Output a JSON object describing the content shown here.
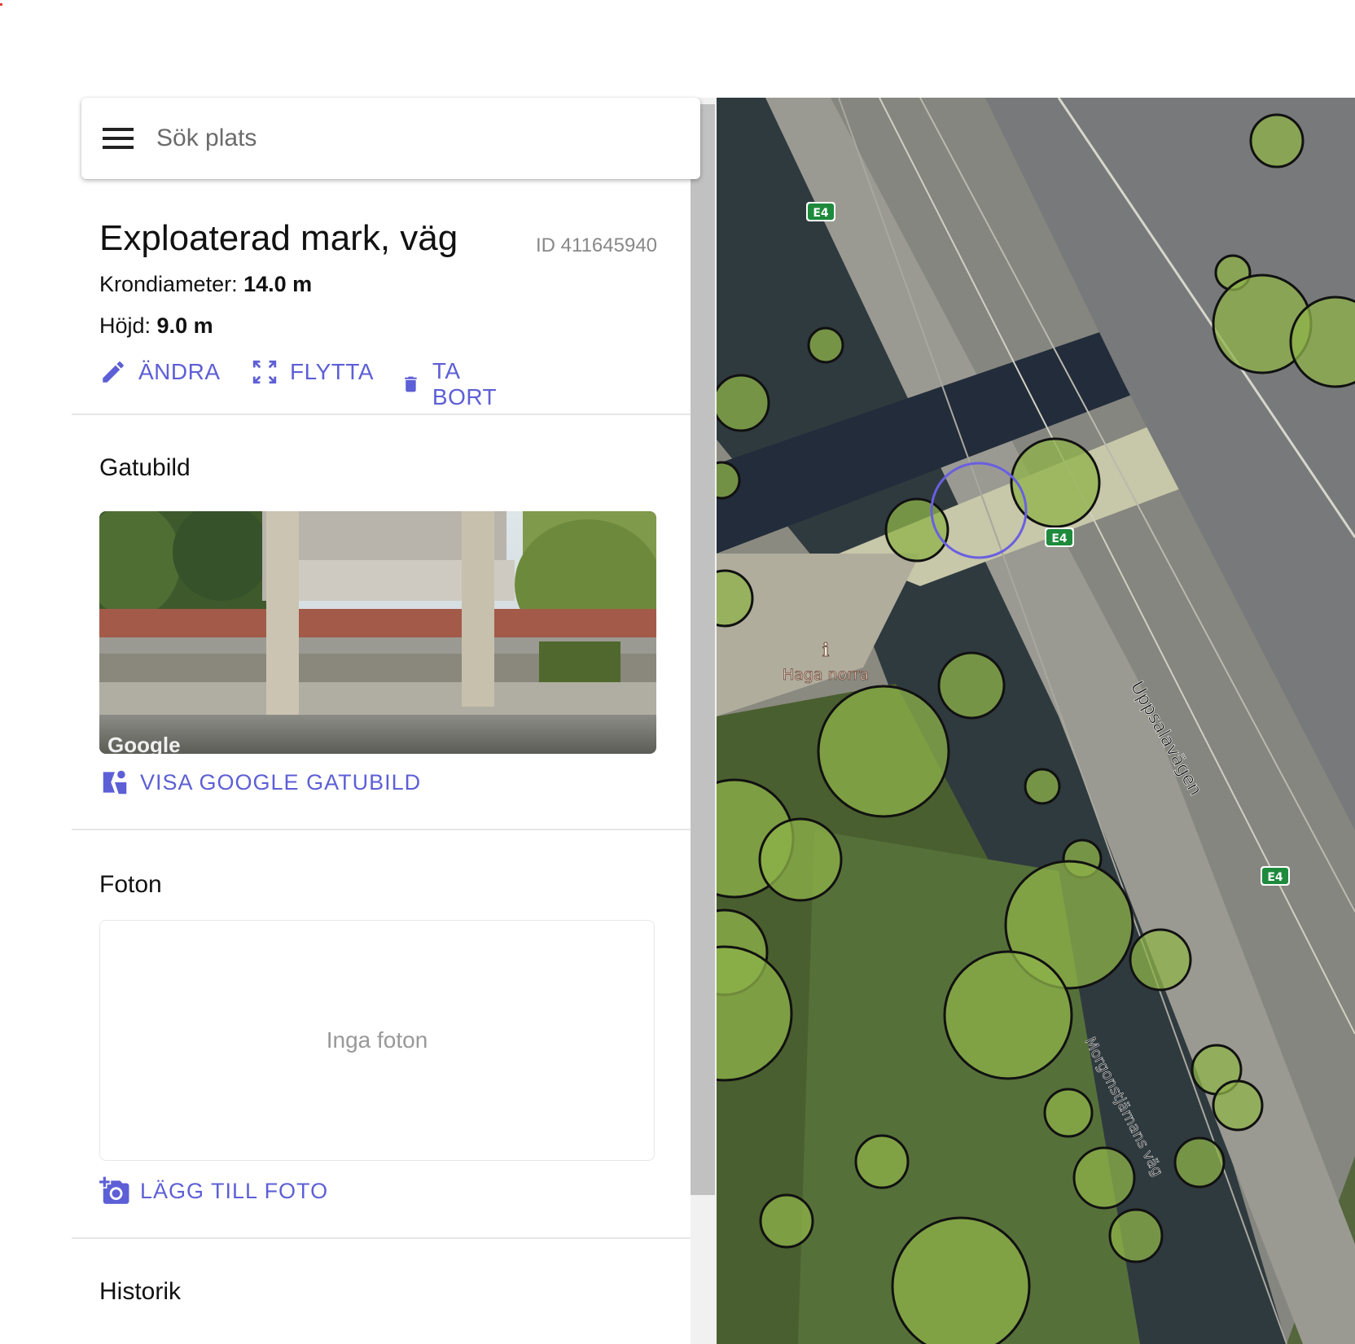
{
  "search": {
    "placeholder": "Sök plats"
  },
  "feature": {
    "title": "Exploaterad mark, väg",
    "id_label": "ID 411645940",
    "crown_label": "Krondiameter:",
    "crown_value": "14.0 m",
    "height_label": "Höjd:",
    "height_value": "9.0 m"
  },
  "actions": {
    "edit": "ÄNDRA",
    "move": "FLYTTA",
    "delete": "TA BORT"
  },
  "streetview": {
    "title": "Gatubild",
    "watermark": "Google",
    "link": "VISA GOOGLE GATUBILD"
  },
  "photos": {
    "title": "Foton",
    "empty": "Inga foton",
    "add": "LÄGG TILL FOTO"
  },
  "history": {
    "title": "Historik"
  },
  "map": {
    "road_shields": [
      "E4",
      "E4",
      "E4"
    ],
    "poi_label": "Haga norra",
    "road_label_1": "Uppsalavägen",
    "road_label_2": "Morgonstjärnans väg"
  },
  "colors": {
    "accent": "#5d5fd6",
    "tree_fill": "#8fb34a",
    "selected_ring": "#6a5fe0",
    "shield": "#1e8a3c"
  }
}
